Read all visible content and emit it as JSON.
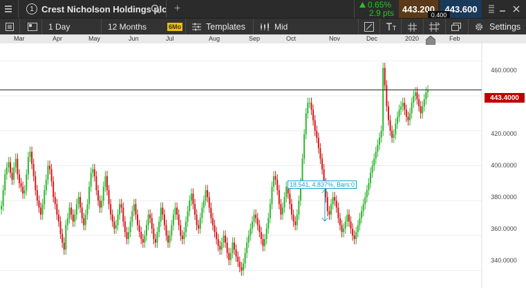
{
  "header": {
    "tab_number": "1",
    "instrument_name": "Crest Nicholson Holdings plc",
    "add_tab": "+",
    "change_pct": "0.65%",
    "change_pts": "2.9 pts",
    "sell_price": "443.200",
    "buy_price": "443.600",
    "spread": "0.400"
  },
  "toolbar": {
    "interval": "1 Day",
    "range": "12 Months",
    "range_badge": "6Mo",
    "templates": "Templates",
    "price_type": "Mid",
    "settings": "Settings"
  },
  "colors": {
    "up": "#2db52d",
    "down": "#d01818",
    "accent": "#16a0d0",
    "price_tag": "#c00000"
  },
  "months": [
    "Mar",
    "Apr",
    "May",
    "Jun",
    "Jul",
    "Aug",
    "Sep",
    "Oct",
    "Nov",
    "Dec",
    "2020",
    "Feb"
  ],
  "y_labels": [
    "460.0000",
    "440.0000",
    "420.0000",
    "400.0000",
    "380.0000",
    "360.0000",
    "340.0000"
  ],
  "current_price_label": "443.4000",
  "measure_annotation": "18.541, 4.837%, Bars:0",
  "chart_data": {
    "type": "candlestick",
    "ylim": [
      330,
      470
    ],
    "current_price": 443.4,
    "y_ticks": [
      340,
      360,
      380,
      400,
      420,
      440,
      460
    ],
    "x_ticks": [
      "Mar",
      "Apr",
      "May",
      "Jun",
      "Jul",
      "Aug",
      "Sep",
      "Oct",
      "Nov",
      "Dec",
      "2020",
      "Feb"
    ],
    "closes": [
      377,
      386,
      395,
      399,
      402,
      396,
      392,
      399,
      404,
      395,
      390,
      388,
      384,
      386,
      395,
      405,
      408,
      401,
      394,
      386,
      380,
      376,
      372,
      378,
      386,
      392,
      400,
      398,
      391,
      382,
      378,
      372,
      368,
      361,
      356,
      352,
      366,
      370,
      376,
      372,
      368,
      372,
      378,
      382,
      376,
      370,
      366,
      372,
      378,
      388,
      396,
      398,
      394,
      386,
      380,
      376,
      380,
      388,
      394,
      386,
      378,
      372,
      368,
      364,
      366,
      372,
      378,
      376,
      368,
      362,
      358,
      362,
      368,
      374,
      378,
      372,
      366,
      362,
      358,
      356,
      360,
      366,
      372,
      370,
      364,
      358,
      356,
      362,
      368,
      376,
      372,
      366,
      360,
      356,
      360,
      366,
      372,
      376,
      372,
      366,
      360,
      358,
      362,
      368,
      374,
      380,
      384,
      378,
      372,
      366,
      364,
      370,
      376,
      380,
      386,
      382,
      376,
      370,
      366,
      362,
      358,
      354,
      352,
      356,
      360,
      356,
      350,
      346,
      350,
      356,
      352,
      348,
      345,
      342,
      340,
      344,
      350,
      356,
      360,
      364,
      368,
      372,
      370,
      366,
      362,
      358,
      354,
      358,
      364,
      370,
      378,
      388,
      394,
      392,
      386,
      378,
      372,
      376,
      382,
      388,
      384,
      378,
      372,
      368,
      366,
      372,
      380,
      390,
      404,
      418,
      430,
      436,
      436,
      432,
      426,
      420,
      416,
      410,
      404,
      398,
      390,
      382,
      374,
      372,
      378,
      382,
      380,
      376,
      370,
      366,
      362,
      364,
      368,
      372,
      368,
      364,
      360,
      358,
      362,
      366,
      370,
      374,
      378,
      382,
      386,
      390,
      396,
      400,
      404,
      408,
      412,
      416,
      420,
      456,
      446,
      434,
      426,
      420,
      416,
      418,
      424,
      428,
      432,
      434,
      436,
      432,
      428,
      426,
      430,
      436,
      440,
      442,
      438,
      434,
      430,
      434,
      438,
      442,
      443
    ]
  }
}
